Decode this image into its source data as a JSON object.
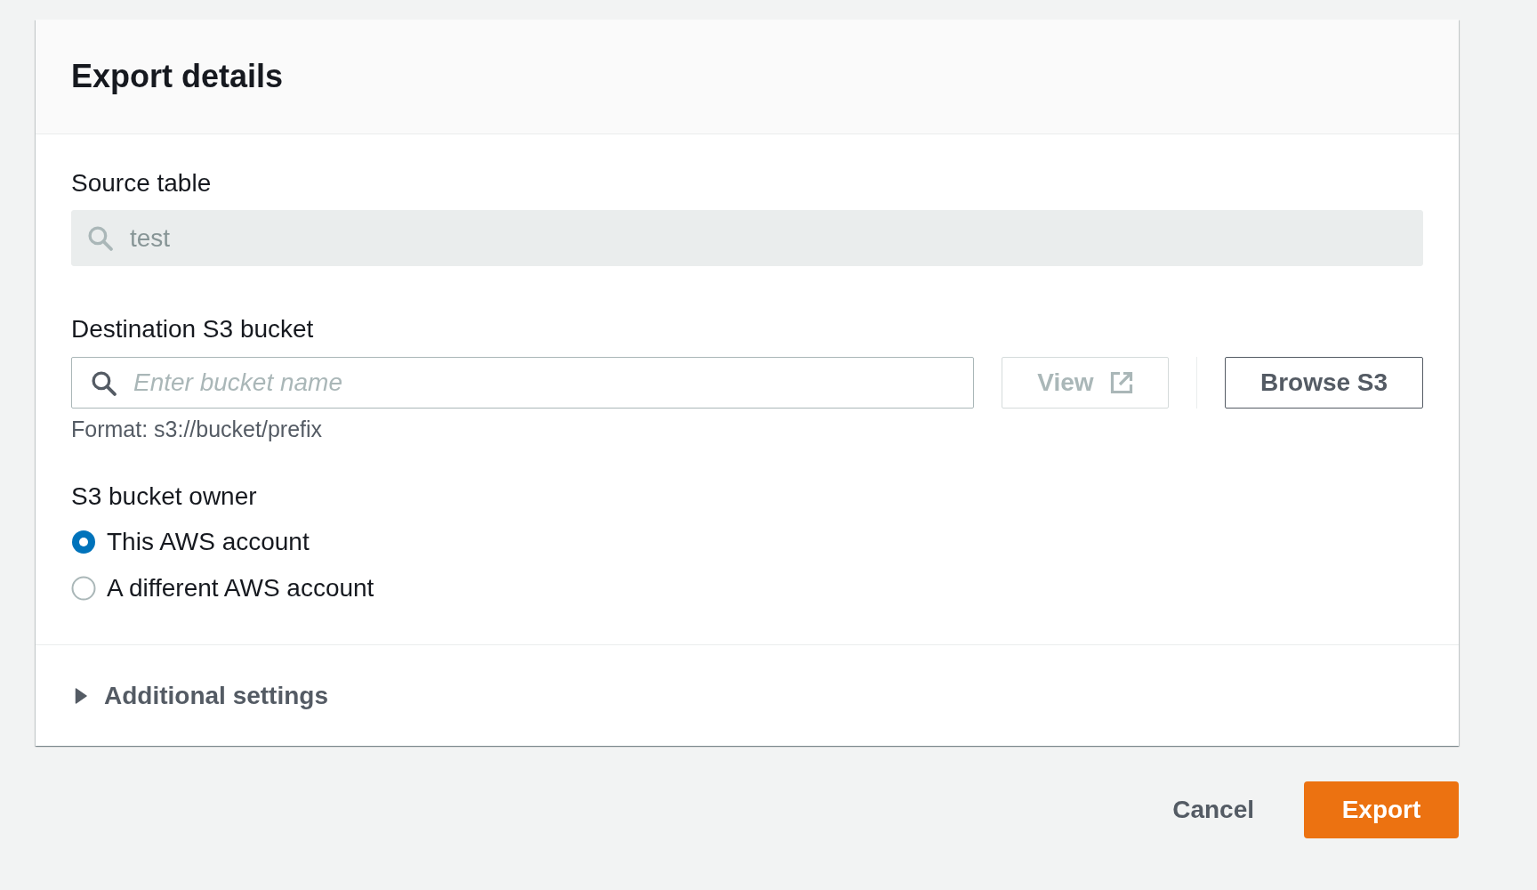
{
  "panel": {
    "title": "Export details"
  },
  "source_table": {
    "label": "Source table",
    "value": "test",
    "disabled": true
  },
  "destination": {
    "label": "Destination S3 bucket",
    "placeholder": "Enter bucket name",
    "hint": "Format: s3://bucket/prefix",
    "buttons": [
      {
        "label": "View",
        "kind": "external",
        "disabled": true
      },
      {
        "label": "Browse S3",
        "kind": "normal",
        "disabled": false
      }
    ]
  },
  "bucket_owner": {
    "label": "S3 bucket owner",
    "options": [
      {
        "label": "This AWS account",
        "selected": true
      },
      {
        "label": "A different AWS account",
        "selected": false
      }
    ]
  },
  "additional_settings": {
    "label": "Additional settings",
    "expanded": false
  },
  "actions": [
    {
      "label": "Cancel",
      "kind": "link"
    },
    {
      "label": "Export",
      "kind": "primary"
    }
  ]
}
